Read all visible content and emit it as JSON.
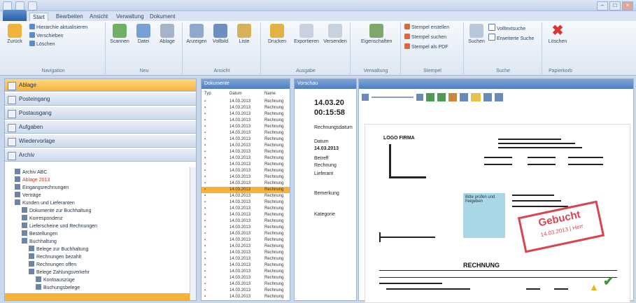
{
  "window": {
    "title": "",
    "controls": [
      "–",
      "□",
      "×"
    ]
  },
  "tabs": [
    "Start",
    "Bearbeiten",
    "Ansicht",
    "Verwaltung",
    "Dokument"
  ],
  "ribbon": {
    "groups": [
      {
        "label": "Navigation",
        "big": "Zurück",
        "small": [
          "Hierarchie aktualisieren",
          "Verschieben",
          "Löschen"
        ]
      },
      {
        "label": "Neu",
        "big": [
          "Scannen",
          "Datei",
          "Ablage"
        ]
      },
      {
        "label": "Ansicht",
        "big": [
          "Anzeigen",
          "Vollbild",
          "Liste"
        ]
      },
      {
        "label": "Ausgabe",
        "big": [
          "Drucken",
          "Exportieren",
          "Versenden"
        ]
      },
      {
        "label": "Verwaltung",
        "big": [
          "Eigenschaften"
        ]
      },
      {
        "label": "Stempel",
        "small": [
          "Stempel erstellen",
          "Stempel suchen",
          "Stempel als PDF"
        ]
      },
      {
        "label": "Suche",
        "big": [
          "Suchen"
        ],
        "small": [
          "Volltextsuche",
          "Erweiterte Suche"
        ]
      },
      {
        "label": "Papierkorb",
        "big": [
          "Löschen"
        ]
      }
    ]
  },
  "nav": {
    "buttons": [
      "Ablage",
      "Posteingang",
      "Postausgang",
      "Aufgaben",
      "Wiedervorlage",
      "Archiv"
    ],
    "tree": [
      "Archiv ABC",
      "Ablage 2013",
      "Eingangsrechnungen",
      "Verträge",
      "Kunden und Lieferanten",
      "Dokumente zur Buchhaltung",
      "Korrespondenz",
      "Lieferscheine und Rechnungen",
      "Bestellungen",
      "Buchhaltung",
      "Belege zur Buchhaltung",
      "Rechnungen bezahlt",
      "Rechnungen offen",
      "Belege Zahlungsverkehr",
      "Kontoauszüge",
      "Buchungsbelege"
    ]
  },
  "list": {
    "header": "Dokumente",
    "columns": [
      "Typ",
      "Datum",
      "Name"
    ],
    "rows": [
      {
        "date": "14.03.2013",
        "name": "Rechnung"
      },
      {
        "date": "14.03.2013",
        "name": "Rechnung"
      },
      {
        "date": "14.03.2013",
        "name": "Rechnung"
      },
      {
        "date": "14.03.2013",
        "name": "Rechnung"
      },
      {
        "date": "14.03.2013",
        "name": "Rechnung"
      },
      {
        "date": "14.03.2013",
        "name": "Rechnung"
      },
      {
        "date": "14.03.2013",
        "name": "Rechnung"
      },
      {
        "date": "14.03.2013",
        "name": "Rechnung"
      },
      {
        "date": "14.03.2013",
        "name": "Rechnung"
      },
      {
        "date": "14.03.2013",
        "name": "Rechnung"
      },
      {
        "date": "14.03.2013",
        "name": "Rechnung"
      },
      {
        "date": "14.03.2013",
        "name": "Rechnung"
      },
      {
        "date": "14.03.2013",
        "name": "Rechnung"
      },
      {
        "date": "14.03.2013",
        "name": "Rechnung"
      },
      {
        "date": "14.03.2013",
        "name": "Rechnung"
      },
      {
        "date": "14.03.2013",
        "name": "Rechnung"
      },
      {
        "date": "14.03.2013",
        "name": "Rechnung"
      },
      {
        "date": "14.03.2013",
        "name": "Rechnung"
      },
      {
        "date": "14.03.2013",
        "name": "Rechnung"
      },
      {
        "date": "14.03.2013",
        "name": "Rechnung"
      },
      {
        "date": "14.03.2013",
        "name": "Rechnung"
      },
      {
        "date": "14.03.2013",
        "name": "Rechnung"
      },
      {
        "date": "14.03.2013",
        "name": "Rechnung"
      },
      {
        "date": "14.03.2013",
        "name": "Rechnung"
      },
      {
        "date": "14.03.2013",
        "name": "Rechnung"
      },
      {
        "date": "14.03.2013",
        "name": "Rechnung"
      },
      {
        "date": "14.03.2013",
        "name": "Rechnung"
      },
      {
        "date": "14.03.2013",
        "name": "Rechnung"
      },
      {
        "date": "14.03.2013",
        "name": "Rechnung"
      },
      {
        "date": "14.03.2013",
        "name": "Rechnung"
      },
      {
        "date": "14.03.2013",
        "name": "Rechnung"
      },
      {
        "date": "14.03.2013",
        "name": "Rechnung"
      }
    ]
  },
  "detail": {
    "header": "Vorschau",
    "date": "14.03.20",
    "time": "00:15:58",
    "fields": [
      "Rechnungsdatum",
      "Datum",
      "14.03.2013",
      "Betreff",
      "Rechnung",
      "Lieferant",
      "Bemerkung",
      "Kategorie"
    ]
  },
  "viewer": {
    "stamp": "Gebucht",
    "stamp_sub": "14.03.2013 | Herr",
    "note": "Bitte prüfen und freigeben",
    "doc_title": "RECHNUNG",
    "hdr_left": "LOGO FIRMA",
    "colors": {
      "stamp": "#d8444f",
      "selection": "#f7b23a",
      "accent": "#4f7fc1"
    }
  }
}
